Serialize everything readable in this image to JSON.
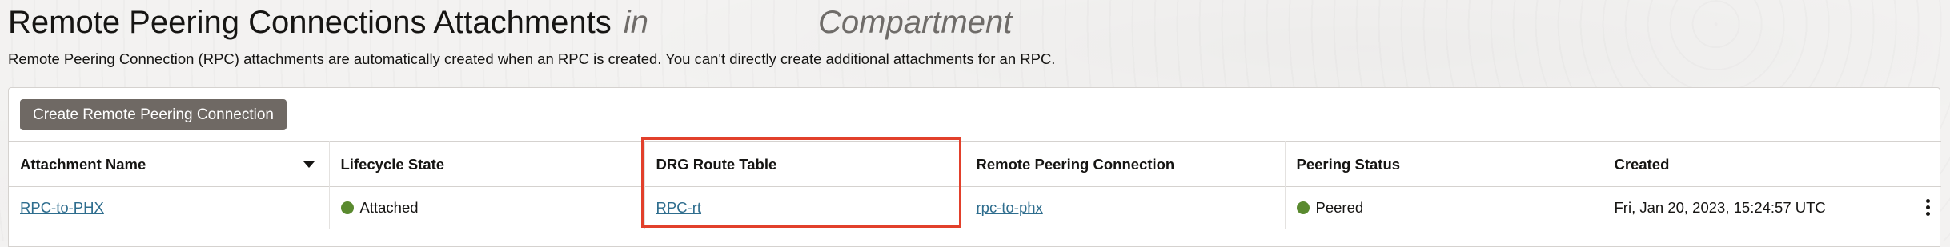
{
  "header": {
    "title": "Remote Peering Connections Attachments",
    "title_in": "in",
    "title_compartment": "Compartment",
    "description": "Remote Peering Connection (RPC) attachments are automatically created when an RPC is created. You can't directly create additional attachments for an RPC."
  },
  "toolbar": {
    "create_label": "Create Remote Peering Connection"
  },
  "table": {
    "columns": [
      "Attachment Name",
      "Lifecycle State",
      "DRG Route Table",
      "Remote Peering Connection",
      "Peering Status",
      "Created"
    ],
    "rows": [
      {
        "attachment_name": "RPC-to-PHX",
        "lifecycle_state": "Attached",
        "drg_route_table": "RPC-rt",
        "remote_peering_connection": "rpc-to-phx",
        "peering_status": "Peered",
        "created": "Fri, Jan 20, 2023, 15:24:57 UTC"
      }
    ]
  },
  "colors": {
    "button_bg": "#6f6964",
    "link": "#2e6d8e",
    "status_green": "#5a8a2f",
    "highlight": "#e2402b"
  },
  "icons": {
    "sort": "chevron-down-icon",
    "actions": "kebab-menu-icon",
    "status": "status-dot-icon"
  }
}
